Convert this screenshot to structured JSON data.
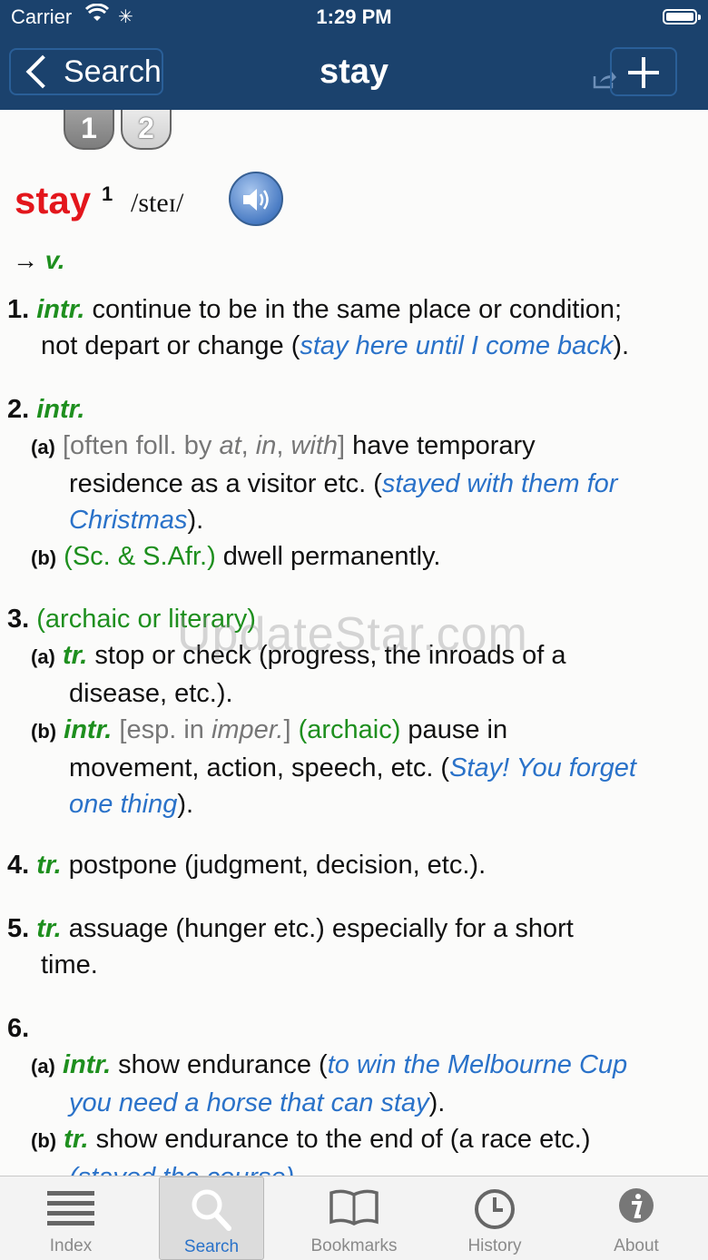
{
  "status": {
    "carrier": "Carrier",
    "time": "1:29 PM"
  },
  "nav": {
    "back_label": "Search",
    "title": "stay"
  },
  "entry": {
    "homographs": [
      "1",
      "2"
    ],
    "headword": "stay",
    "homograph_sup": "1",
    "pronunciation": "/steɪ/",
    "pos_arrow": "→",
    "pos": "v.",
    "senses": {
      "s1": {
        "num": "1.",
        "label": "intr.",
        "text_a": " continue to be in the same place or condition;",
        "text_b": "not depart or change (",
        "example": "stay here until I come back",
        "text_c": ")."
      },
      "s2": {
        "num": "2.",
        "label": "intr.",
        "a": {
          "marker": "(a)",
          "gram_open": "[often foll. by ",
          "w1": "at",
          "c1": ", ",
          "w2": "in",
          "c2": ", ",
          "w3": "with",
          "gram_close": "]",
          "text_a": " have temporary",
          "text_b": "residence as a visitor etc. (",
          "example_a": "stayed with them for",
          "example_b": "Christmas",
          "text_c": ")."
        },
        "b": {
          "marker": "(b)",
          "region": "(Sc. & S.Afr.)",
          "text": " dwell permanently."
        }
      },
      "s3": {
        "num": "3.",
        "register": "(archaic or literary)",
        "a": {
          "marker": "(a)",
          "label": "tr.",
          "text_a": " stop or check (progress, the inroads of a",
          "text_b": "disease, etc.)."
        },
        "b": {
          "marker": "(b)",
          "label": "intr.",
          "gram_open": " [esp. in ",
          "gram_word": "imper.",
          "gram_close": "]",
          "register": " (archaic)",
          "text_a": " pause in",
          "text_b": "movement, action, speech, etc. (",
          "example_a": "Stay! You forget",
          "example_b": "one thing",
          "text_c": ")."
        }
      },
      "s4": {
        "num": "4.",
        "label": "tr.",
        "text": " postpone (judgment, decision, etc.)."
      },
      "s5": {
        "num": "5.",
        "label": "tr.",
        "text_a": " assuage (hunger etc.) especially for a short",
        "text_b": "time."
      },
      "s6": {
        "num": "6.",
        "a": {
          "marker": "(a)",
          "label": "intr.",
          "text_a": " show endurance (",
          "example_a": "to win the Melbourne Cup",
          "example_b": "you need a horse that can stay",
          "text_c": ")."
        },
        "b": {
          "marker": "(b)",
          "label": "tr.",
          "text_a": " show endurance to the end of (a race etc.)",
          "example_partial": "(stayed the course)"
        }
      }
    }
  },
  "watermark": "UpdateStar.com",
  "tabs": [
    {
      "label": "Index",
      "icon": "list-icon"
    },
    {
      "label": "Search",
      "icon": "magnifier-icon"
    },
    {
      "label": "Bookmarks",
      "icon": "book-icon"
    },
    {
      "label": "History",
      "icon": "clock-icon"
    },
    {
      "label": "About",
      "icon": "info-icon"
    }
  ],
  "colors": {
    "nav": "#1b426d",
    "headword": "#e3161c",
    "label": "#1e8f1e",
    "example": "#2a72c9",
    "tab_active": "#2a72c9"
  }
}
